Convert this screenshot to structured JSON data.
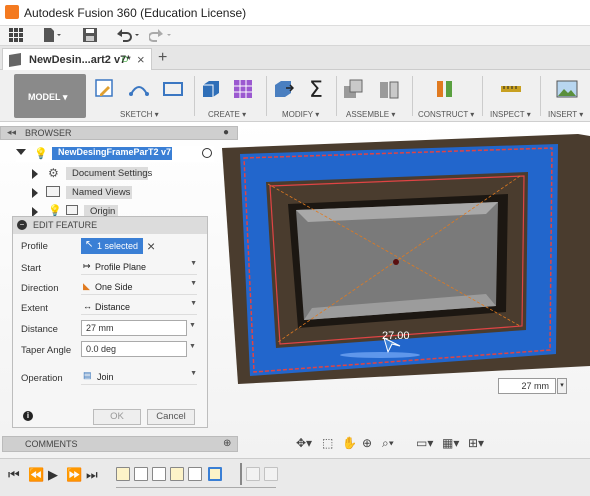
{
  "window": {
    "title": "Autodesk Fusion 360 (Education License)"
  },
  "document_tab": {
    "label": "NewDesin...art2 v7*"
  },
  "toolbar": {
    "workspace_label": "MODEL ▾",
    "groups": [
      {
        "label": "SKETCH ▾",
        "color": "#3b77c2"
      },
      {
        "label": "CREATE ▾",
        "color": "#2f6fb8"
      },
      {
        "label": "MODIFY ▾",
        "color": "#4a7fc0"
      },
      {
        "label": "ASSEMBLE ▾",
        "color": "#7d7d7d"
      },
      {
        "label": "CONSTRUCT ▾",
        "color": "#e07a20"
      },
      {
        "label": "INSPECT ▾",
        "color": "#c8a020"
      },
      {
        "label": "INSERT ▾",
        "color": "#5a8f3c"
      }
    ]
  },
  "browser": {
    "header": "BROWSER",
    "root": "NewDesingFrameParT2 v7",
    "items": [
      "Document Settings",
      "Named Views",
      "Origin"
    ]
  },
  "edit_feature": {
    "header": "EDIT FEATURE",
    "fields": {
      "profile_label": "Profile",
      "profile_value": "1 selected",
      "start_label": "Start",
      "start_value": "Profile Plane",
      "direction_label": "Direction",
      "direction_value": "One Side",
      "extent_label": "Extent",
      "extent_value": "Distance",
      "distance_label": "Distance",
      "distance_value": "27 mm",
      "taper_label": "Taper Angle",
      "taper_value": "0.0 deg",
      "operation_label": "Operation",
      "operation_value": "Join"
    },
    "ok_label": "OK",
    "cancel_label": "Cancel"
  },
  "viewport": {
    "dimension_label": "27.00",
    "distance_input": "27 mm"
  },
  "comments": {
    "header": "COMMENTS"
  },
  "colors": {
    "frame_blue": "#2266cc",
    "frame_brown": "#4a3c2e",
    "accent_red": "#e04444",
    "selected_blue": "#3a7fd5"
  }
}
